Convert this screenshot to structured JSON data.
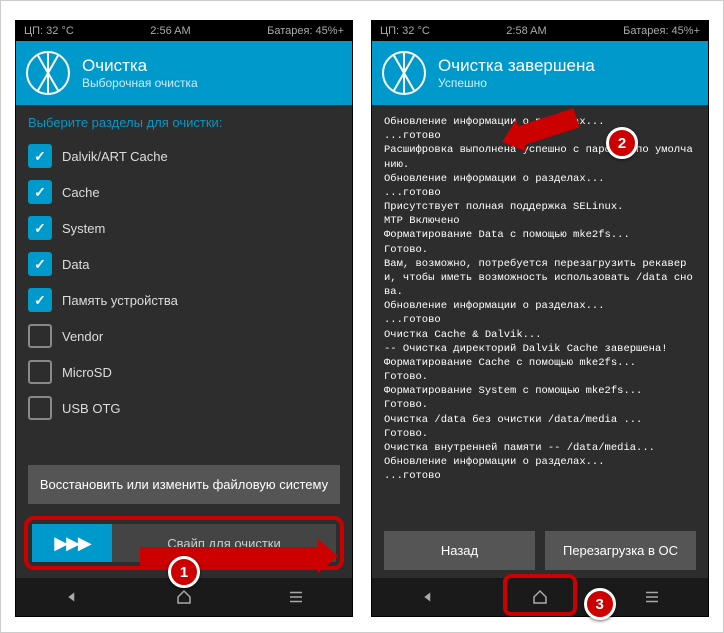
{
  "left": {
    "status": {
      "cpu": "ЦП: 32 °C",
      "time": "2:56 AM",
      "battery": "Батарея: 45%+"
    },
    "header": {
      "title": "Очистка",
      "subtitle": "Выборочная очистка"
    },
    "section_label": "Выберите разделы для очистки:",
    "partitions": [
      {
        "label": "Dalvik/ART Cache",
        "checked": true
      },
      {
        "label": "Cache",
        "checked": true
      },
      {
        "label": "System",
        "checked": true
      },
      {
        "label": "Data",
        "checked": true
      },
      {
        "label": "Память устройства",
        "checked": true
      },
      {
        "label": "Vendor",
        "checked": false
      },
      {
        "label": "MicroSD",
        "checked": false
      },
      {
        "label": "USB OTG",
        "checked": false
      }
    ],
    "fs_button": "Восстановить или изменить файловую систему",
    "swipe_label": "Свайп для очистки",
    "callout": "1"
  },
  "right": {
    "status": {
      "cpu": "ЦП: 32 °C",
      "time": "2:58 AM",
      "battery": "Батарея: 45%+"
    },
    "header": {
      "title": "Очистка завершена",
      "subtitle": "Успешно"
    },
    "log": "Обновление информации о разделах...\n...готово\nРасшифровка выполнена успешно с паролем по умолчанию.\nОбновление информации о разделах...\n...готово\nПрисутствует полная поддержка SELinux.\nMTP Включено\nФорматирование Data с помощью mke2fs...\nГотово.\nВам, возможно, потребуется перезагрузить рекавери, чтобы иметь возможность использовать /data снова.\nОбновление информации о разделах...\n...готово\nОчистка Cache & Dalvik...\n-- Очистка директорий Dalvik Cache завершена!\nФорматирование Cache с помощью mke2fs...\nГотово.\nФорматирование System с помощью mke2fs...\nГотово.\nОчистка /data без очистки /data/media ...\nГотово.\nОчистка внутренней памяти -- /data/media...\nОбновление информации о разделах...\n...готово",
    "back_button": "Назад",
    "reboot_button": "Перезагрузка в ОС",
    "callout2": "2",
    "callout3": "3"
  },
  "colors": {
    "accent": "#0099cc",
    "highlight": "#c00"
  }
}
